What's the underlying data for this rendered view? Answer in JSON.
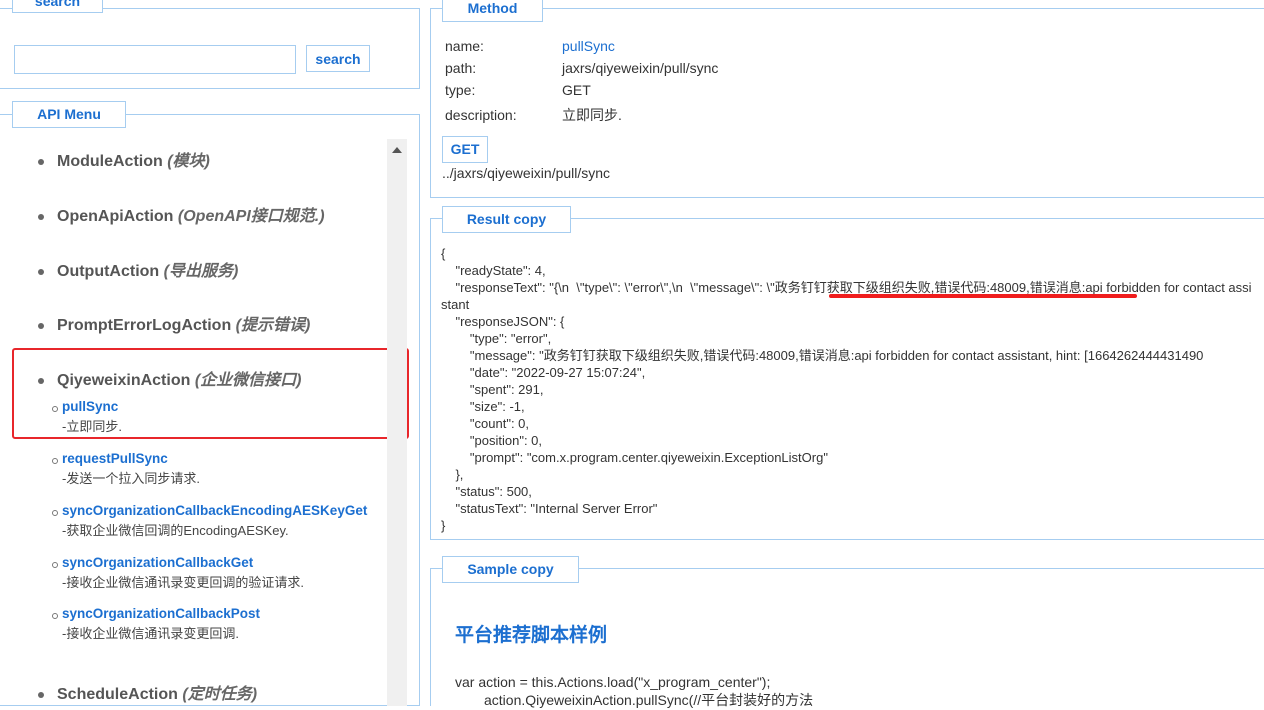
{
  "search": {
    "legend": "search",
    "input_value": "",
    "button": "search"
  },
  "menu": {
    "legend": "API Menu",
    "items": [
      {
        "name": "ModuleAction",
        "desc": "(模块)"
      },
      {
        "name": "OpenApiAction",
        "desc": "(OpenAPI接口规范.)"
      },
      {
        "name": "OutputAction",
        "desc": "(导出服务)"
      },
      {
        "name": "PromptErrorLogAction",
        "desc": "(提示错误)"
      },
      {
        "name": "QiyeweixinAction",
        "desc": "(企业微信接口)"
      },
      {
        "name": "ScheduleAction",
        "desc": "(定时任务)"
      }
    ],
    "subitems": [
      {
        "name": "pullSync",
        "desc": "-立即同步."
      },
      {
        "name": "requestPullSync",
        "desc": "-发送一个拉入同步请求."
      },
      {
        "name": "syncOrganizationCallbackEncodingAESKeyGet",
        "desc": "-获取企业微信回调的EncodingAESKey."
      },
      {
        "name": "syncOrganizationCallbackGet",
        "desc": "-接收企业微信通讯录变更回调的验证请求."
      },
      {
        "name": "syncOrganizationCallbackPost",
        "desc": "-接收企业微信通讯录变更回调."
      }
    ]
  },
  "method": {
    "legend": "Method",
    "name_label": "name:",
    "name": "pullSync",
    "path_label": "path:",
    "path": "jaxrs/qiyeweixin/pull/sync",
    "type_label": "type:",
    "type": "GET",
    "desc_label": "description:",
    "desc": "立即同步.",
    "button": "GET",
    "url": "../jaxrs/qiyeweixin/pull/sync"
  },
  "result": {
    "legend": "Result copy",
    "text": "{\n    \"readyState\": 4,\n    \"responseText\": \"{\\n  \\\"type\\\": \\\"error\\\",\\n  \\\"message\\\": \\\"政务钉钉获取下级组织失败,错误代码:48009,错误消息:api forbidden for contact assistant\n    \"responseJSON\": {\n        \"type\": \"error\",\n        \"message\": \"政务钉钉获取下级组织失败,错误代码:48009,错误消息:api forbidden for contact assistant, hint: [1664262444431490\n        \"date\": \"2022-09-27 15:07:24\",\n        \"spent\": 291,\n        \"size\": -1,\n        \"count\": 0,\n        \"position\": 0,\n        \"prompt\": \"com.x.program.center.qiyeweixin.ExceptionListOrg\"\n    },\n    \"status\": 500,\n    \"statusText\": \"Internal Server Error\"\n}"
  },
  "sample": {
    "legend": "Sample copy",
    "heading": "平台推荐脚本样例",
    "line1": "var action = this.Actions.load(\"x_program_center\");",
    "line2": "action.QiyeweixinAction.pullSync(//平台封装好的方法"
  }
}
